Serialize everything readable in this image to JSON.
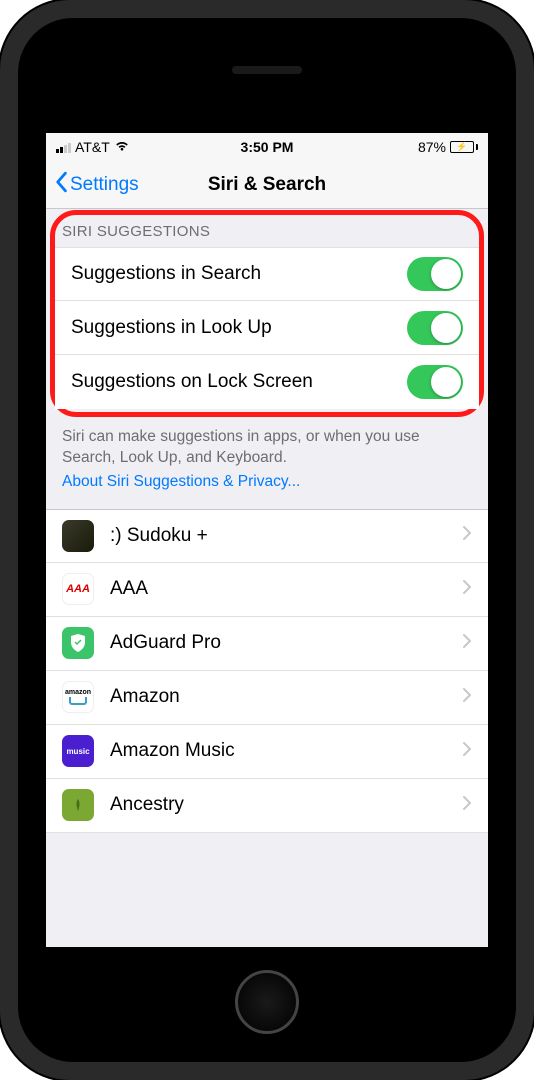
{
  "status": {
    "carrier": "AT&T",
    "time": "3:50 PM",
    "battery_pct": "87%"
  },
  "nav": {
    "back": "Settings",
    "title": "Siri & Search"
  },
  "section_header": "SIRI SUGGESTIONS",
  "toggles": [
    {
      "label": "Suggestions in Search",
      "on": true
    },
    {
      "label": "Suggestions in Look Up",
      "on": true
    },
    {
      "label": "Suggestions on Lock Screen",
      "on": true
    }
  ],
  "footer": "Siri can make suggestions in apps, or when you use Search, Look Up, and Keyboard.",
  "footer_link": "About Siri Suggestions & Privacy...",
  "apps": [
    {
      "name": ":) Sudoku +",
      "icon": "sudoku"
    },
    {
      "name": "AAA",
      "icon": "aaa"
    },
    {
      "name": "AdGuard Pro",
      "icon": "adguard"
    },
    {
      "name": "Amazon",
      "icon": "amazon"
    },
    {
      "name": "Amazon Music",
      "icon": "amazon-music"
    },
    {
      "name": "Ancestry",
      "icon": "ancestry"
    }
  ]
}
